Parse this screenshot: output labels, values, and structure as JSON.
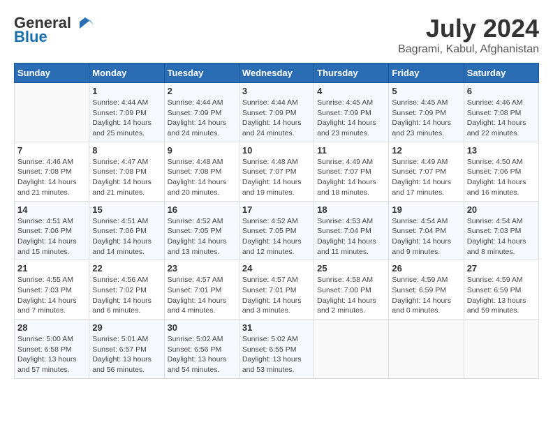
{
  "header": {
    "logo_general": "General",
    "logo_blue": "Blue",
    "month_year": "July 2024",
    "location": "Bagrami, Kabul, Afghanistan"
  },
  "days_of_week": [
    "Sunday",
    "Monday",
    "Tuesday",
    "Wednesday",
    "Thursday",
    "Friday",
    "Saturday"
  ],
  "weeks": [
    [
      {
        "day": "",
        "sunrise": "",
        "sunset": "",
        "daylight": ""
      },
      {
        "day": "1",
        "sunrise": "Sunrise: 4:44 AM",
        "sunset": "Sunset: 7:09 PM",
        "daylight": "Daylight: 14 hours and 25 minutes."
      },
      {
        "day": "2",
        "sunrise": "Sunrise: 4:44 AM",
        "sunset": "Sunset: 7:09 PM",
        "daylight": "Daylight: 14 hours and 24 minutes."
      },
      {
        "day": "3",
        "sunrise": "Sunrise: 4:44 AM",
        "sunset": "Sunset: 7:09 PM",
        "daylight": "Daylight: 14 hours and 24 minutes."
      },
      {
        "day": "4",
        "sunrise": "Sunrise: 4:45 AM",
        "sunset": "Sunset: 7:09 PM",
        "daylight": "Daylight: 14 hours and 23 minutes."
      },
      {
        "day": "5",
        "sunrise": "Sunrise: 4:45 AM",
        "sunset": "Sunset: 7:09 PM",
        "daylight": "Daylight: 14 hours and 23 minutes."
      },
      {
        "day": "6",
        "sunrise": "Sunrise: 4:46 AM",
        "sunset": "Sunset: 7:08 PM",
        "daylight": "Daylight: 14 hours and 22 minutes."
      }
    ],
    [
      {
        "day": "7",
        "sunrise": "Sunrise: 4:46 AM",
        "sunset": "Sunset: 7:08 PM",
        "daylight": "Daylight: 14 hours and 21 minutes."
      },
      {
        "day": "8",
        "sunrise": "Sunrise: 4:47 AM",
        "sunset": "Sunset: 7:08 PM",
        "daylight": "Daylight: 14 hours and 21 minutes."
      },
      {
        "day": "9",
        "sunrise": "Sunrise: 4:48 AM",
        "sunset": "Sunset: 7:08 PM",
        "daylight": "Daylight: 14 hours and 20 minutes."
      },
      {
        "day": "10",
        "sunrise": "Sunrise: 4:48 AM",
        "sunset": "Sunset: 7:07 PM",
        "daylight": "Daylight: 14 hours and 19 minutes."
      },
      {
        "day": "11",
        "sunrise": "Sunrise: 4:49 AM",
        "sunset": "Sunset: 7:07 PM",
        "daylight": "Daylight: 14 hours and 18 minutes."
      },
      {
        "day": "12",
        "sunrise": "Sunrise: 4:49 AM",
        "sunset": "Sunset: 7:07 PM",
        "daylight": "Daylight: 14 hours and 17 minutes."
      },
      {
        "day": "13",
        "sunrise": "Sunrise: 4:50 AM",
        "sunset": "Sunset: 7:06 PM",
        "daylight": "Daylight: 14 hours and 16 minutes."
      }
    ],
    [
      {
        "day": "14",
        "sunrise": "Sunrise: 4:51 AM",
        "sunset": "Sunset: 7:06 PM",
        "daylight": "Daylight: 14 hours and 15 minutes."
      },
      {
        "day": "15",
        "sunrise": "Sunrise: 4:51 AM",
        "sunset": "Sunset: 7:06 PM",
        "daylight": "Daylight: 14 hours and 14 minutes."
      },
      {
        "day": "16",
        "sunrise": "Sunrise: 4:52 AM",
        "sunset": "Sunset: 7:05 PM",
        "daylight": "Daylight: 14 hours and 13 minutes."
      },
      {
        "day": "17",
        "sunrise": "Sunrise: 4:52 AM",
        "sunset": "Sunset: 7:05 PM",
        "daylight": "Daylight: 14 hours and 12 minutes."
      },
      {
        "day": "18",
        "sunrise": "Sunrise: 4:53 AM",
        "sunset": "Sunset: 7:04 PM",
        "daylight": "Daylight: 14 hours and 11 minutes."
      },
      {
        "day": "19",
        "sunrise": "Sunrise: 4:54 AM",
        "sunset": "Sunset: 7:04 PM",
        "daylight": "Daylight: 14 hours and 9 minutes."
      },
      {
        "day": "20",
        "sunrise": "Sunrise: 4:54 AM",
        "sunset": "Sunset: 7:03 PM",
        "daylight": "Daylight: 14 hours and 8 minutes."
      }
    ],
    [
      {
        "day": "21",
        "sunrise": "Sunrise: 4:55 AM",
        "sunset": "Sunset: 7:03 PM",
        "daylight": "Daylight: 14 hours and 7 minutes."
      },
      {
        "day": "22",
        "sunrise": "Sunrise: 4:56 AM",
        "sunset": "Sunset: 7:02 PM",
        "daylight": "Daylight: 14 hours and 6 minutes."
      },
      {
        "day": "23",
        "sunrise": "Sunrise: 4:57 AM",
        "sunset": "Sunset: 7:01 PM",
        "daylight": "Daylight: 14 hours and 4 minutes."
      },
      {
        "day": "24",
        "sunrise": "Sunrise: 4:57 AM",
        "sunset": "Sunset: 7:01 PM",
        "daylight": "Daylight: 14 hours and 3 minutes."
      },
      {
        "day": "25",
        "sunrise": "Sunrise: 4:58 AM",
        "sunset": "Sunset: 7:00 PM",
        "daylight": "Daylight: 14 hours and 2 minutes."
      },
      {
        "day": "26",
        "sunrise": "Sunrise: 4:59 AM",
        "sunset": "Sunset: 6:59 PM",
        "daylight": "Daylight: 14 hours and 0 minutes."
      },
      {
        "day": "27",
        "sunrise": "Sunrise: 4:59 AM",
        "sunset": "Sunset: 6:59 PM",
        "daylight": "Daylight: 13 hours and 59 minutes."
      }
    ],
    [
      {
        "day": "28",
        "sunrise": "Sunrise: 5:00 AM",
        "sunset": "Sunset: 6:58 PM",
        "daylight": "Daylight: 13 hours and 57 minutes."
      },
      {
        "day": "29",
        "sunrise": "Sunrise: 5:01 AM",
        "sunset": "Sunset: 6:57 PM",
        "daylight": "Daylight: 13 hours and 56 minutes."
      },
      {
        "day": "30",
        "sunrise": "Sunrise: 5:02 AM",
        "sunset": "Sunset: 6:56 PM",
        "daylight": "Daylight: 13 hours and 54 minutes."
      },
      {
        "day": "31",
        "sunrise": "Sunrise: 5:02 AM",
        "sunset": "Sunset: 6:55 PM",
        "daylight": "Daylight: 13 hours and 53 minutes."
      },
      {
        "day": "",
        "sunrise": "",
        "sunset": "",
        "daylight": ""
      },
      {
        "day": "",
        "sunrise": "",
        "sunset": "",
        "daylight": ""
      },
      {
        "day": "",
        "sunrise": "",
        "sunset": "",
        "daylight": ""
      }
    ]
  ]
}
